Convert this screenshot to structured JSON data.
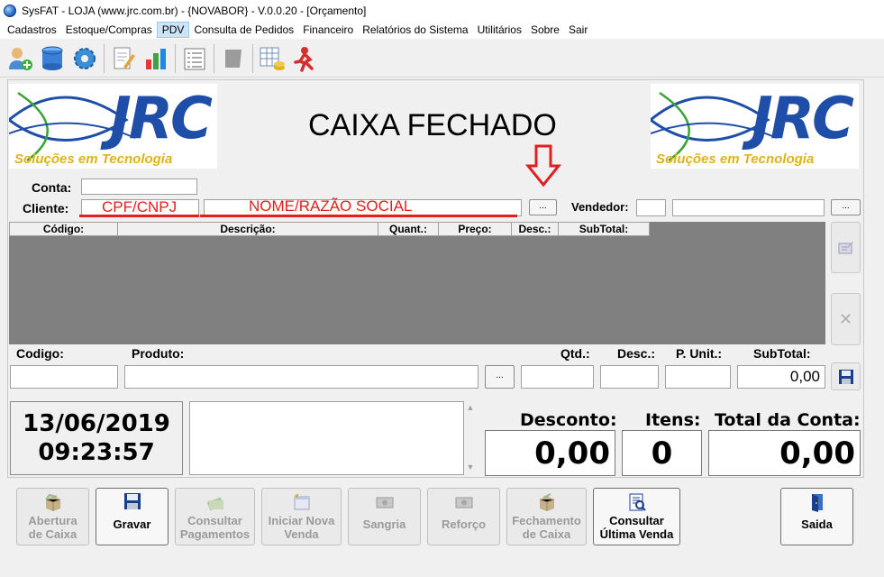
{
  "window": {
    "title": "SysFAT - LOJA (www.jrc.com.br) - {NOVABOR} - V.0.0.20 - [Orçamento]"
  },
  "menu": [
    "Cadastros",
    "Estoque/Compras",
    "PDV",
    "Consulta de Pedidos",
    "Financeiro",
    "Relatórios do Sistema",
    "Utilitários",
    "Sobre",
    "Sair"
  ],
  "logo": {
    "brand": "JRC",
    "tagline": "Soluções em Tecnologia"
  },
  "status": "CAIXA FECHADO",
  "form": {
    "conta_label": "Conta:",
    "cliente_label": "Cliente:",
    "vendedor_label": "Vendedor:",
    "cpf_overlay": "CPF/CNPJ",
    "nome_overlay": "NOME/RAZÃO SOCIAL",
    "dots": "..."
  },
  "grid": {
    "columns": [
      "Código:",
      "Descrição:",
      "Quant.:",
      "Preço:",
      "Desc.:",
      "SubTotal:"
    ]
  },
  "entry": {
    "codigo_label": "Codigo:",
    "produto_label": "Produto:",
    "qtd_label": "Qtd.:",
    "desc_label": "Desc.:",
    "punit_label": "P. Unit.:",
    "subtotal_label": "SubTotal:",
    "subtotal_value": "0,00"
  },
  "clock": {
    "date": "13/06/2019",
    "time": "09:23:57"
  },
  "totals": {
    "desconto_label": "Desconto:",
    "itens_label": "Itens:",
    "total_label": "Total da Conta:",
    "desconto_value": "0,00",
    "itens_value": "0",
    "total_value": "0,00"
  },
  "actions": {
    "abertura": [
      "Abertura",
      "de Caixa"
    ],
    "gravar": [
      "Gravar"
    ],
    "consultar_pag": [
      "Consultar",
      "Pagamentos"
    ],
    "iniciar": [
      "Iniciar Nova",
      "Venda"
    ],
    "sangria": [
      "Sangria"
    ],
    "reforco": [
      "Reforço"
    ],
    "fechamento": [
      "Fechamento",
      "de Caixa"
    ],
    "ultima": [
      "Consultar",
      "Última Venda"
    ],
    "saida": [
      "Saida"
    ]
  },
  "colors": {
    "accent_red": "#e02020",
    "brand_blue": "#1f4ea8",
    "brand_gold": "#e0b318",
    "grid_bg": "#808080"
  }
}
